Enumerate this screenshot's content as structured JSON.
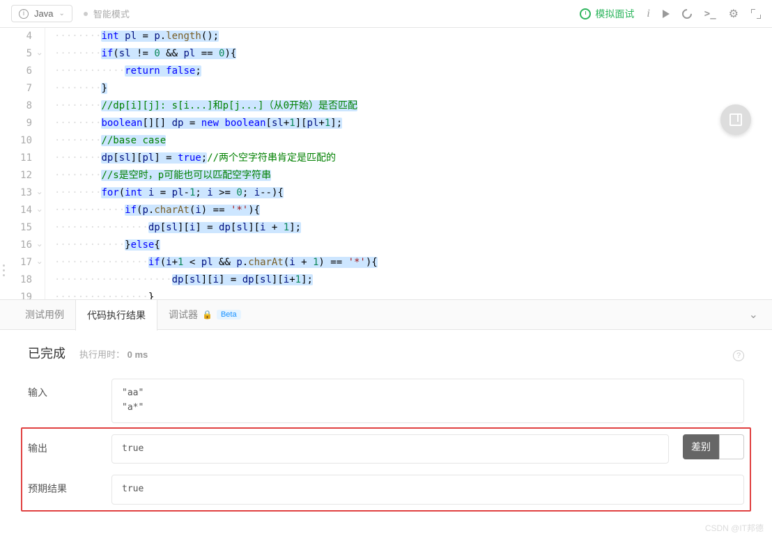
{
  "toolbar": {
    "language": "Java",
    "mode": "智能模式",
    "mock_interview": "模拟面试"
  },
  "code": {
    "lines": [
      {
        "n": 4,
        "html": "<span class='ws'>········</span><span class='hl'><span class='kw'>int</span> <span class='id'>pl</span> = <span class='id'>p</span>.<span class='fn'>length</span>();</span>"
      },
      {
        "n": 5,
        "fold": true,
        "html": "<span class='ws'>········</span><span class='hl'><span class='kw'>if</span>(<span class='id'>sl</span> != <span class='num'>0</span> && <span class='id'>pl</span> == <span class='num'>0</span>){</span>"
      },
      {
        "n": 6,
        "html": "<span class='ws'>············</span><span class='hl'><span class='kw'>return</span> <span class='bool'>false</span>;</span>"
      },
      {
        "n": 7,
        "html": "<span class='ws'>········</span><span class='hl'>}</span>"
      },
      {
        "n": 8,
        "html": "<span class='ws'>········</span><span class='hl'><span class='cmt'>//dp[i][j]: s[i...]和p[j...]（从0开始）是否匹配</span></span>"
      },
      {
        "n": 9,
        "html": "<span class='ws'>········</span><span class='hl'><span class='kw'>boolean</span>[][] <span class='id'>dp</span> = <span class='kw'>new</span> <span class='kw'>boolean</span>[<span class='id'>sl</span>+<span class='num'>1</span>][<span class='id'>pl</span>+<span class='num'>1</span>];</span>"
      },
      {
        "n": 10,
        "html": "<span class='ws'>········</span><span class='hl'><span class='cmt'>//base case</span></span>"
      },
      {
        "n": 11,
        "html": "<span class='ws'>········</span><span class='hl'><span class='id'>dp</span>[<span class='id'>sl</span>][<span class='id'>pl</span>] = <span class='bool'>true</span>;</span><span class='cmt'>//两个空字符串肯定是匹配的</span>"
      },
      {
        "n": 12,
        "html": "<span class='ws'>········</span><span class='hl'><span class='cmt'>//s是空时，p可能也可以匹配空字符串</span></span>"
      },
      {
        "n": 13,
        "fold": true,
        "html": "<span class='ws'>········</span><span class='hl'><span class='kw'>for</span>(<span class='kw'>int</span> <span class='id'>i</span> = <span class='id'>pl</span>-<span class='num'>1</span>; <span class='id'>i </span>>= <span class='num'>0</span>; <span class='id'>i</span>--){</span>"
      },
      {
        "n": 14,
        "fold": true,
        "html": "<span class='ws'>············</span><span class='hl'><span class='kw'>if</span>(<span class='id'>p</span>.<span class='fn'>charAt</span>(<span class='id'>i</span>) == <span class='str'>'*'</span>){</span>"
      },
      {
        "n": 15,
        "html": "<span class='ws'>················</span><span class='hl'><span class='id'>dp</span>[<span class='id'>sl</span>][<span class='id'>i</span>] = <span class='id'>dp</span>[<span class='id'>sl</span>][<span class='id'>i</span> + <span class='num'>1</span>];</span>"
      },
      {
        "n": 16,
        "fold": true,
        "html": "<span class='ws'>············</span><span class='hl'>}<span class='kw'>else</span>{</span>"
      },
      {
        "n": 17,
        "fold": true,
        "html": "<span class='ws'>················</span><span class='hl'><span class='kw'>if</span>(<span class='id'>i</span>+<span class='num'>1</span> &lt; <span class='id'>pl</span> && <span class='id'>p</span>.<span class='fn'>charAt</span>(<span class='id'>i</span> + <span class='num'>1</span>) == <span class='str'>'*'</span>){</span>"
      },
      {
        "n": 18,
        "html": "<span class='ws'>····················</span><span class='hl'><span class='id'>dp</span>[<span class='id'>sl</span>][<span class='id'>i</span>] = <span class='id'>dp</span>[<span class='id'>sl</span>][<span class='id'>i</span>+<span class='num'>1</span>];</span>"
      },
      {
        "n": 19,
        "html": "<span class='ws'>················</span>}"
      }
    ]
  },
  "tabs": {
    "testcase": "测试用例",
    "result": "代码执行结果",
    "debugger": "调试器",
    "beta": "Beta"
  },
  "results": {
    "status": "已完成",
    "runtime_label": "执行用时：",
    "runtime_value": "0 ms",
    "input_label": "输入",
    "input_value": "\"aa\"\n\"a*\"",
    "output_label": "输出",
    "output_value": "true",
    "expected_label": "预期结果",
    "expected_value": "true",
    "diff_button": "差别"
  },
  "watermark": "CSDN @IT邦德"
}
